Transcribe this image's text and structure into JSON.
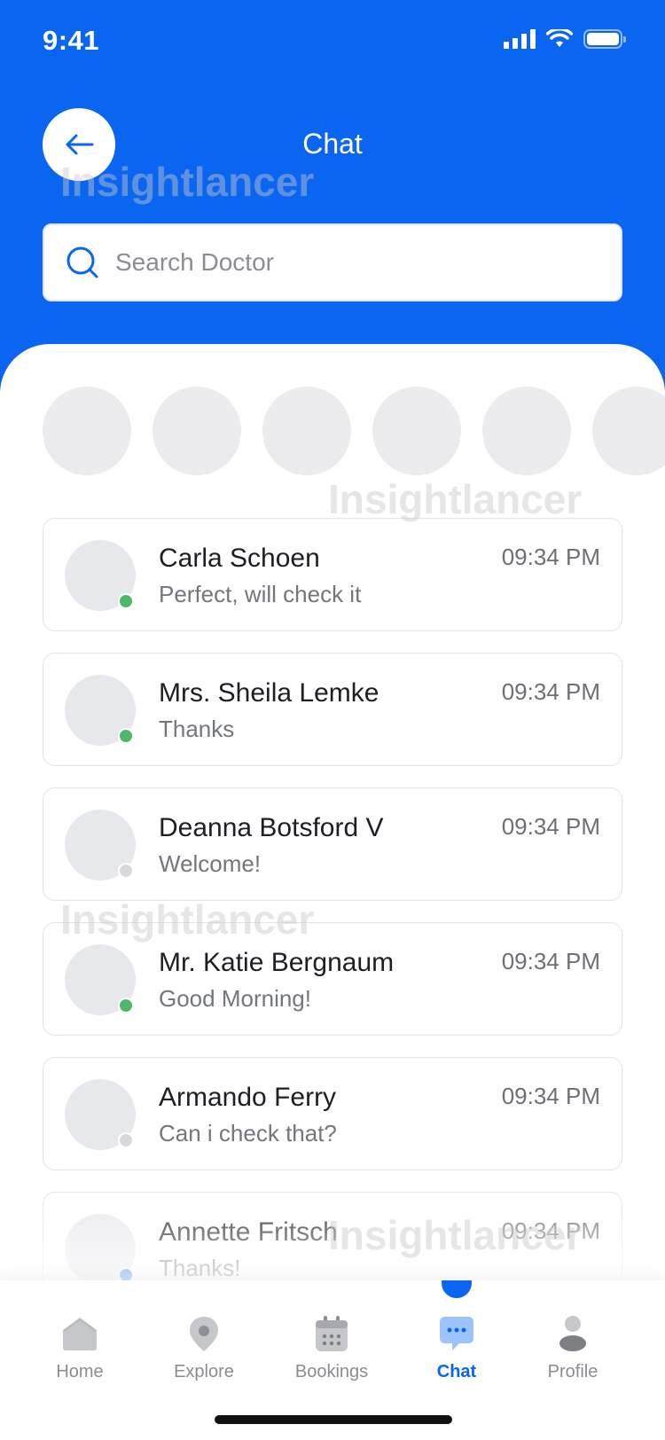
{
  "status_bar": {
    "time": "9:41"
  },
  "header": {
    "title": "Chat"
  },
  "search": {
    "placeholder": "Search Doctor"
  },
  "stories": [
    {
      "name": "doctor-1"
    },
    {
      "name": "doctor-2"
    },
    {
      "name": "doctor-3"
    },
    {
      "name": "doctor-4"
    },
    {
      "name": "doctor-5"
    },
    {
      "name": "doctor-6"
    }
  ],
  "chats": [
    {
      "name": "Carla Schoen",
      "message": "Perfect, will check it",
      "time": "09:34 PM",
      "status": "online"
    },
    {
      "name": "Mrs. Sheila Lemke",
      "message": "Thanks",
      "time": "09:34 PM",
      "status": "online"
    },
    {
      "name": "Deanna Botsford V",
      "message": "Welcome!",
      "time": "09:34 PM",
      "status": "offline"
    },
    {
      "name": "Mr. Katie Bergnaum",
      "message": "Good Morning!",
      "time": "09:34 PM",
      "status": "online"
    },
    {
      "name": "Armando Ferry",
      "message": "Can i check that?",
      "time": "09:34 PM",
      "status": "offline"
    },
    {
      "name": "Annette Fritsch",
      "message": "Thanks!",
      "time": "09:34 PM",
      "status": "active"
    }
  ],
  "tabbar": {
    "items": [
      {
        "label": "Home",
        "icon": "home-icon"
      },
      {
        "label": "Explore",
        "icon": "location-pin-icon"
      },
      {
        "label": "Bookings",
        "icon": "calendar-icon"
      },
      {
        "label": "Chat",
        "icon": "chat-bubble-icon",
        "active": true
      },
      {
        "label": "Profile",
        "icon": "user-icon"
      }
    ]
  },
  "watermark": "Insightlancer",
  "colors": {
    "primary": "#0a66f0",
    "online": "#4cb86a",
    "offline": "#d8d9dd",
    "active": "#0a66f0"
  }
}
